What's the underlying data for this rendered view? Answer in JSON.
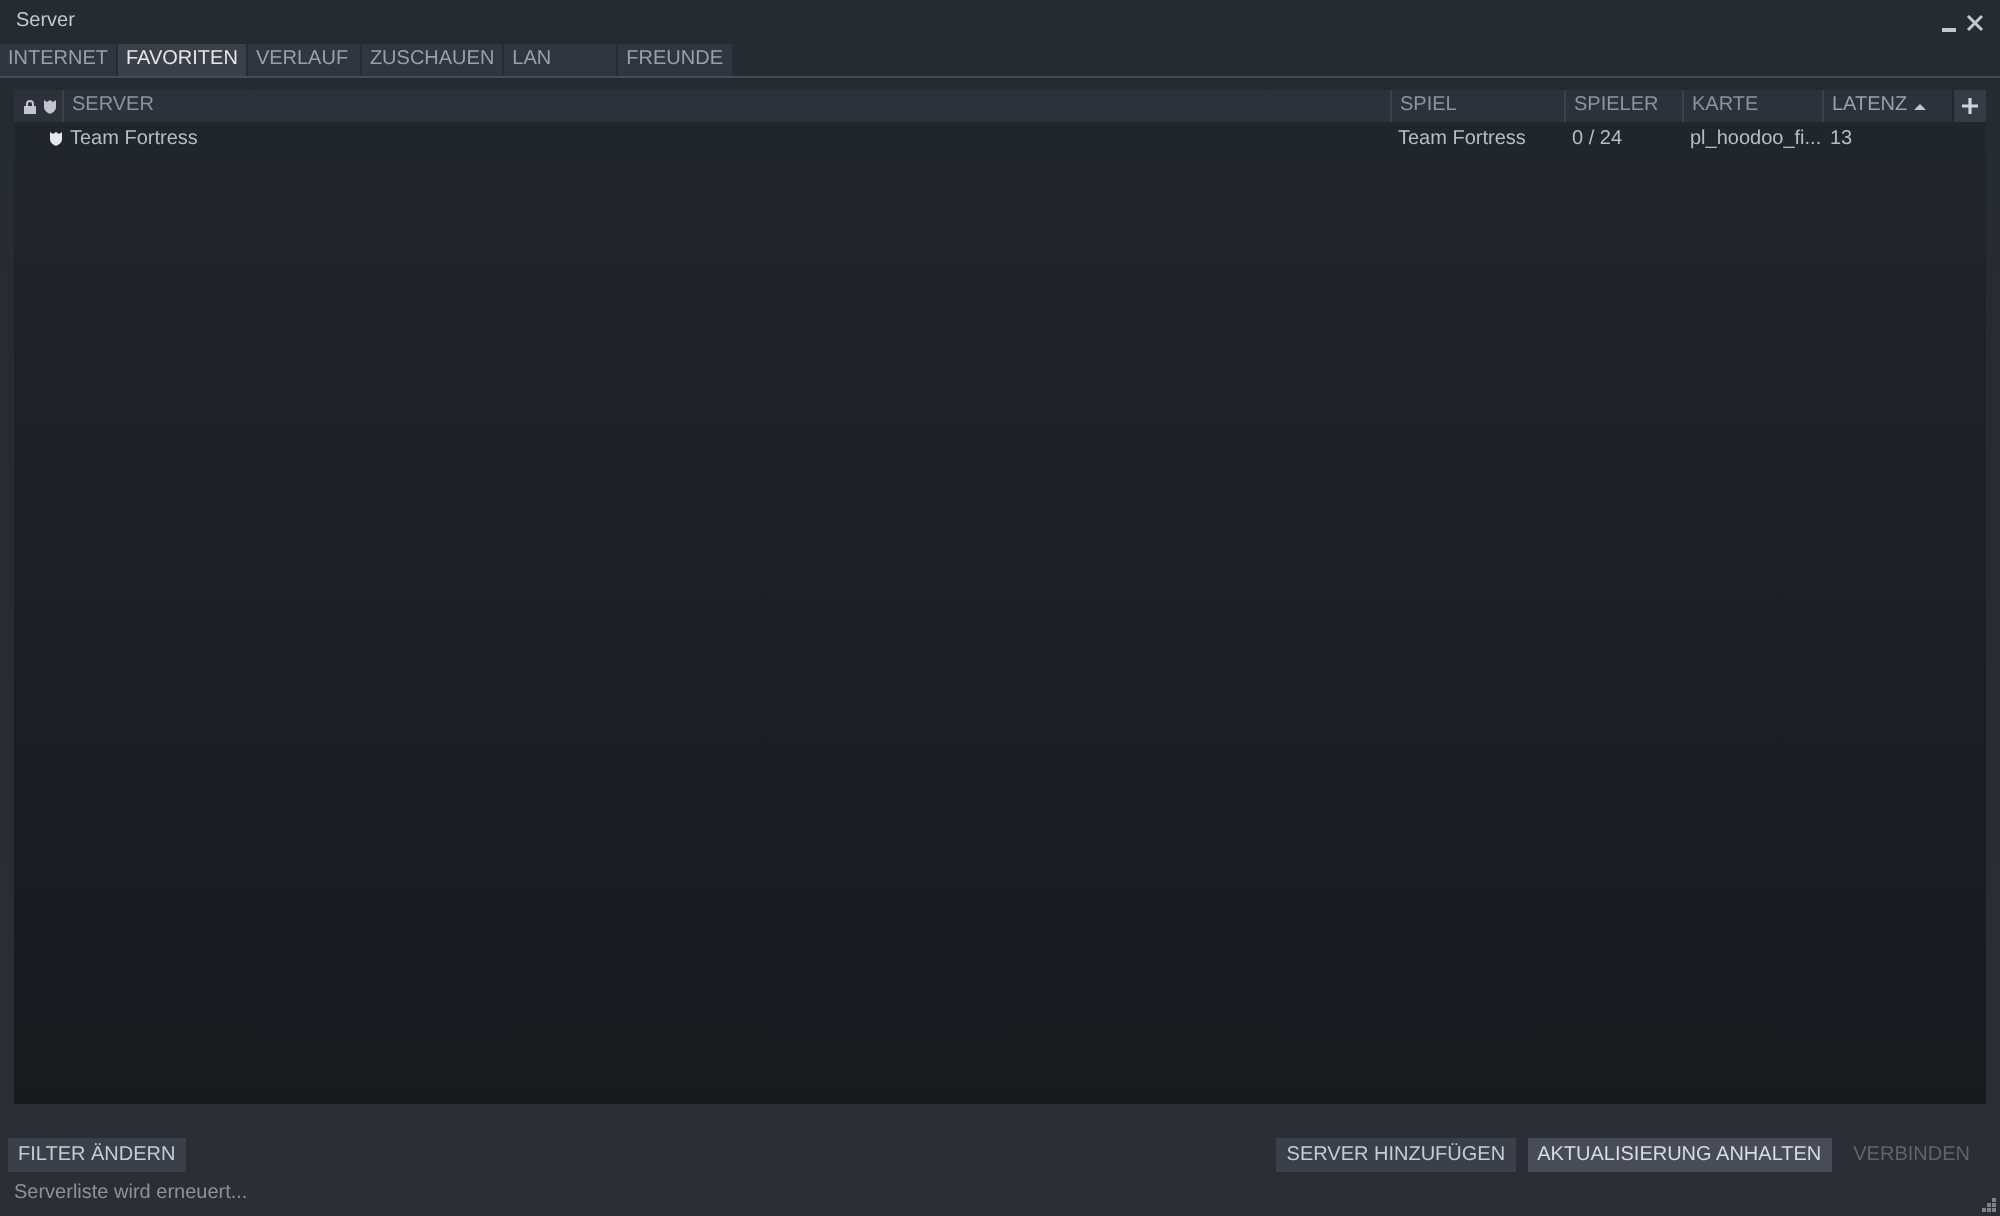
{
  "window": {
    "title": "Server"
  },
  "tabs": [
    {
      "label": "INTERNET",
      "selected": false
    },
    {
      "label": "FAVORITEN",
      "selected": true
    },
    {
      "label": "VERLAUF",
      "selected": false
    },
    {
      "label": "ZUSCHAUEN",
      "selected": false
    },
    {
      "label": "LAN",
      "selected": false
    },
    {
      "label": "FREUNDE",
      "selected": false
    }
  ],
  "table": {
    "columns": [
      {
        "label": "SERVER",
        "sorted": false
      },
      {
        "label": "SPIEL",
        "sorted": false
      },
      {
        "label": "SPIELER",
        "sorted": false
      },
      {
        "label": "KARTE",
        "sorted": false
      },
      {
        "label": "LATENZ",
        "sorted": true
      }
    ],
    "rows": [
      {
        "locked": false,
        "secure": true,
        "cells": [
          "Team Fortress",
          "Team Fortress",
          "0 / 24",
          "pl_hoodoo_fi...",
          "13"
        ]
      }
    ]
  },
  "filter_button": {
    "label": "FILTER ÄNDERN"
  },
  "buttons": [
    {
      "label": "SERVER HINZUFÜGEN",
      "focused": false,
      "disabled": false
    },
    {
      "label": "AKTUALISIERUNG ANHALTEN",
      "focused": true,
      "disabled": false
    },
    {
      "label": "VERBINDEN",
      "focused": false,
      "disabled": true
    }
  ],
  "status_bar": "Serverliste wird erneuert..."
}
